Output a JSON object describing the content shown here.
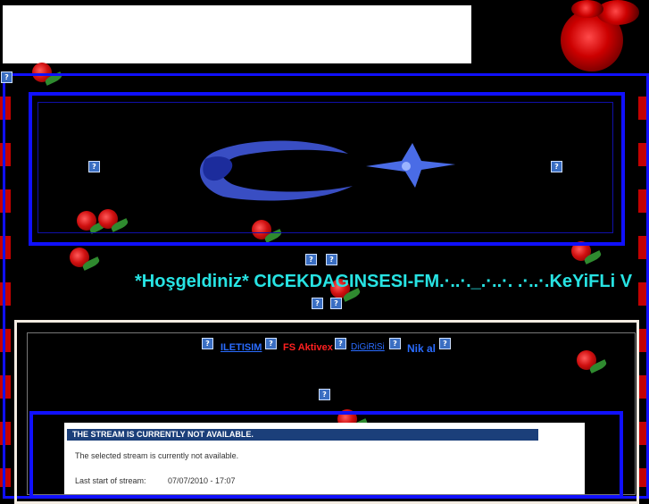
{
  "welcome_text": "*Hoşgeldiniz* CICEKDAGINSESI-FM.·..·._.·..·. .·..·.KeYiFLi V",
  "nav": {
    "iletisim": "ILETISIM",
    "fs_aktivex": "FS Aktivex",
    "dj_girisi": "DiGiRiSi",
    "nik_al": "Nik al"
  },
  "stream": {
    "title": "THE STREAM IS CURRENTLY NOT AVAILABLE.",
    "message": "The selected stream is currently not available.",
    "last_start_label": "Last start of stream:",
    "last_start_value": "07/07/2010 - 17:07"
  },
  "colors": {
    "frame_blue": "#1010ff",
    "welcome_cyan": "#27e3e3",
    "nav_blue": "#2a6cff",
    "nav_red": "#ff2020",
    "stream_header": "#1b3f7a"
  },
  "icons": [
    "broken-image-icon",
    "rose-icon",
    "star-logo-icon"
  ]
}
